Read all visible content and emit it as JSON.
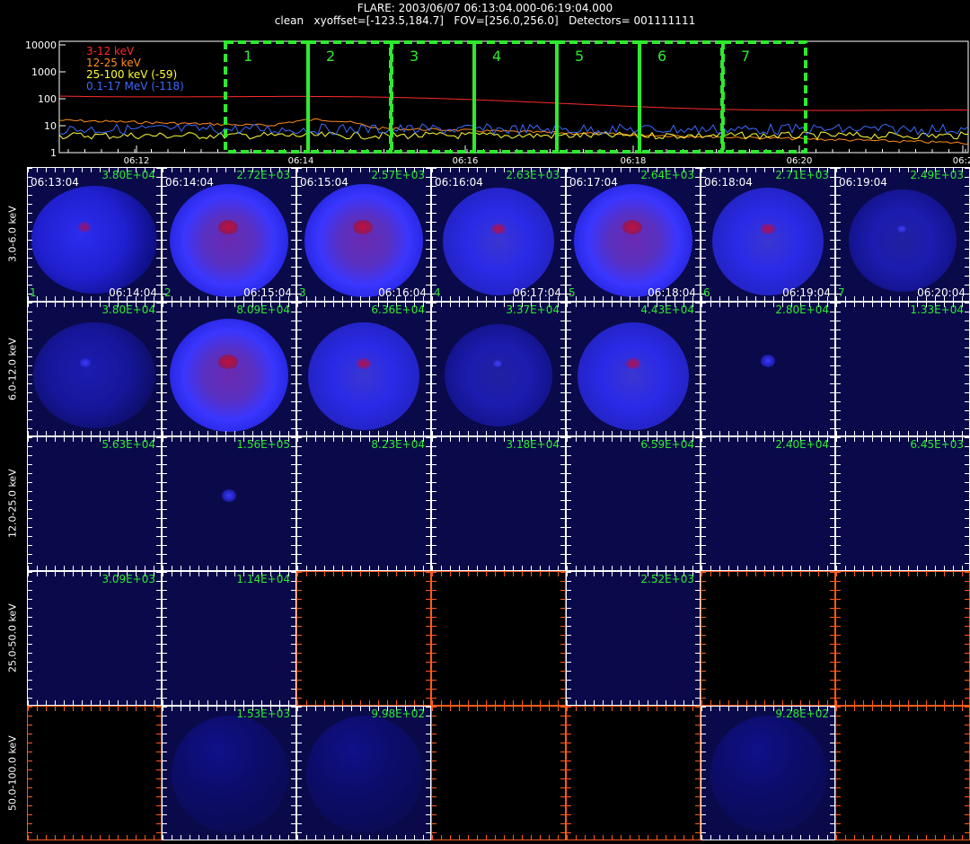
{
  "header": {
    "line1": "FLARE: 2003/06/07 06:13:04.000-06:19:04.000",
    "line2": "clean   xyoffset=[-123.5,184.7]   FOV=[256.0,256.0]   Detectors= 001111111"
  },
  "lightcurve": {
    "yticks": [
      "10000",
      "1000",
      "100",
      "10",
      "1"
    ],
    "xticks": [
      "06:12",
      "06:14",
      "06:16",
      "06:18",
      "06:20",
      "06:2"
    ],
    "legend": [
      {
        "label": "3-12 keV",
        "color": "#ff2a2a"
      },
      {
        "label": "12-25 keV",
        "color": "#ff8c1a"
      },
      {
        "label": "25-100 keV (-59)",
        "color": "#ffff33"
      },
      {
        "label": "0.1-17 MeV (-118)",
        "color": "#3a6aff"
      }
    ],
    "intervals": [
      "1",
      "2",
      "3",
      "4",
      "5",
      "6",
      "7"
    ],
    "interval_color": "#2eea2e"
  },
  "rows": [
    {
      "label": "3.0-6.0  keV",
      "cells": [
        {
          "flux": "3.80E+04",
          "start": "06:13:04",
          "end": "06:14:04",
          "idx": "1",
          "img": "patchy"
        },
        {
          "flux": "2.72E+03",
          "start": "06:14:04",
          "end": "06:15:04",
          "idx": "2",
          "img": "ring-strong"
        },
        {
          "flux": "2.57E+03",
          "start": "06:15:04",
          "end": "06:16:04",
          "idx": "3",
          "img": "ring-strong"
        },
        {
          "flux": "2.63E+03",
          "start": "06:16:04",
          "end": "06:17:04",
          "idx": "4",
          "img": "ring"
        },
        {
          "flux": "2.64E+03",
          "start": "06:17:04",
          "end": "06:18:04",
          "idx": "5",
          "img": "ring-strong"
        },
        {
          "flux": "2.71E+03",
          "start": "06:18:04",
          "end": "06:19:04",
          "idx": "6",
          "img": "ring"
        },
        {
          "flux": "2.49E+03",
          "start": "06:19:04",
          "end": "06:20:04",
          "idx": "7",
          "img": "ring-faint"
        }
      ]
    },
    {
      "label": "6.0-12.0  keV",
      "cells": [
        {
          "flux": "3.80E+04",
          "img": "patchy-faint"
        },
        {
          "flux": "8.09E+04",
          "img": "ring-strong"
        },
        {
          "flux": "6.36E+04",
          "img": "ring"
        },
        {
          "flux": "3.37E+04",
          "img": "ring-faint"
        },
        {
          "flux": "4.43E+04",
          "img": "ring"
        },
        {
          "flux": "2.80E+04",
          "img": "dot"
        },
        {
          "flux": "1.33E+04",
          "img": "blank"
        }
      ]
    },
    {
      "label": "12.0-25.0  keV",
      "cells": [
        {
          "flux": "5.63E+04",
          "img": "blank"
        },
        {
          "flux": "1.56E+05",
          "img": "dot"
        },
        {
          "flux": "8.23E+04",
          "img": "blank"
        },
        {
          "flux": "3.18E+04",
          "img": "blank"
        },
        {
          "flux": "6.59E+04",
          "img": "blank"
        },
        {
          "flux": "2.40E+04",
          "img": "blank"
        },
        {
          "flux": "6.45E+03",
          "img": "blank"
        }
      ]
    },
    {
      "label": "25.0-50.0  keV",
      "cells": [
        {
          "flux": "3.09E+03",
          "img": "blank"
        },
        {
          "flux": "1.14E+04",
          "img": "blank"
        },
        {
          "flux": "",
          "img": "empty"
        },
        {
          "flux": "",
          "img": "empty"
        },
        {
          "flux": "2.52E+03",
          "img": "blank"
        },
        {
          "flux": "",
          "img": "empty"
        },
        {
          "flux": "",
          "img": "empty"
        }
      ]
    },
    {
      "label": "50.0-100.0  keV",
      "cells": [
        {
          "flux": "",
          "img": "empty"
        },
        {
          "flux": "1.53E+03",
          "img": "speckle"
        },
        {
          "flux": "9.98E+02",
          "img": "speckle"
        },
        {
          "flux": "",
          "img": "empty"
        },
        {
          "flux": "",
          "img": "empty"
        },
        {
          "flux": "9.28E+02",
          "img": "speckle"
        },
        {
          "flux": "",
          "img": "empty"
        }
      ]
    }
  ]
}
